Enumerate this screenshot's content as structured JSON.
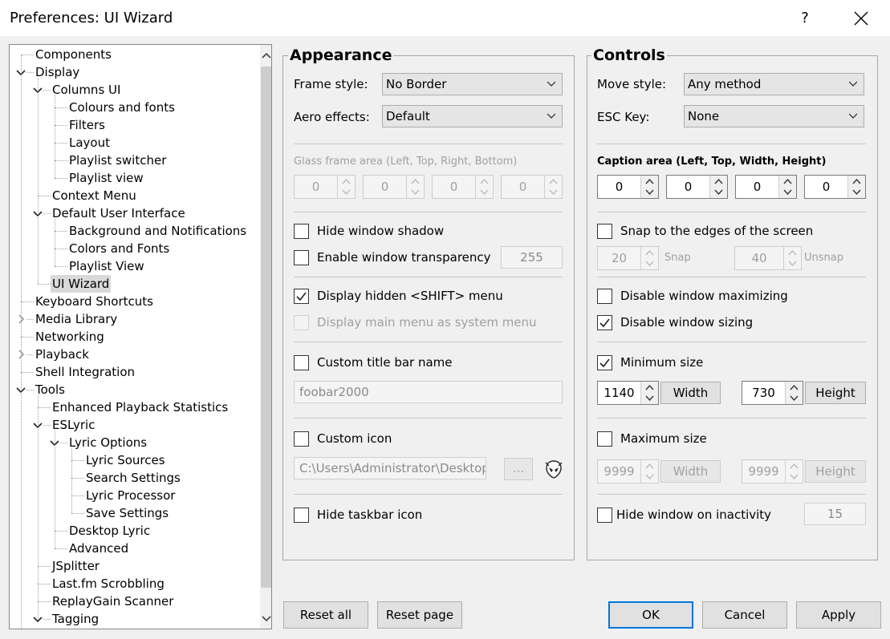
{
  "window": {
    "title": "Preferences: UI Wizard",
    "help": "?"
  },
  "tree": [
    {
      "label": "Components",
      "level": 0,
      "state": "leaf"
    },
    {
      "label": "Display",
      "level": 0,
      "state": "expanded"
    },
    {
      "label": "Columns UI",
      "level": 1,
      "state": "expanded"
    },
    {
      "label": "Colours and fonts",
      "level": 2,
      "state": "leaf"
    },
    {
      "label": "Filters",
      "level": 2,
      "state": "leaf"
    },
    {
      "label": "Layout",
      "level": 2,
      "state": "leaf"
    },
    {
      "label": "Playlist switcher",
      "level": 2,
      "state": "leaf"
    },
    {
      "label": "Playlist view",
      "level": 2,
      "state": "leaf"
    },
    {
      "label": "Context Menu",
      "level": 1,
      "state": "leaf"
    },
    {
      "label": "Default User Interface",
      "level": 1,
      "state": "expanded"
    },
    {
      "label": "Background and Notifications",
      "level": 2,
      "state": "leaf"
    },
    {
      "label": "Colors and Fonts",
      "level": 2,
      "state": "leaf"
    },
    {
      "label": "Playlist View",
      "level": 2,
      "state": "leaf"
    },
    {
      "label": "UI Wizard",
      "level": 1,
      "state": "leaf",
      "selected": true
    },
    {
      "label": "Keyboard Shortcuts",
      "level": 0,
      "state": "leaf"
    },
    {
      "label": "Media Library",
      "level": 0,
      "state": "collapsed"
    },
    {
      "label": "Networking",
      "level": 0,
      "state": "leaf"
    },
    {
      "label": "Playback",
      "level": 0,
      "state": "collapsed"
    },
    {
      "label": "Shell Integration",
      "level": 0,
      "state": "leaf"
    },
    {
      "label": "Tools",
      "level": 0,
      "state": "expanded"
    },
    {
      "label": "Enhanced Playback Statistics",
      "level": 1,
      "state": "leaf"
    },
    {
      "label": "ESLyric",
      "level": 1,
      "state": "expanded"
    },
    {
      "label": "Lyric Options",
      "level": 2,
      "state": "expanded"
    },
    {
      "label": "Lyric Sources",
      "level": 3,
      "state": "leaf"
    },
    {
      "label": "Search Settings",
      "level": 3,
      "state": "leaf"
    },
    {
      "label": "Lyric Processor",
      "level": 3,
      "state": "leaf"
    },
    {
      "label": "Save Settings",
      "level": 3,
      "state": "leaf"
    },
    {
      "label": "Desktop Lyric",
      "level": 2,
      "state": "leaf"
    },
    {
      "label": "Advanced",
      "level": 2,
      "state": "leaf"
    },
    {
      "label": "JSplitter",
      "level": 1,
      "state": "leaf"
    },
    {
      "label": "Last.fm Scrobbling",
      "level": 1,
      "state": "leaf"
    },
    {
      "label": "ReplayGain Scanner",
      "level": 1,
      "state": "leaf"
    },
    {
      "label": "Tagging",
      "level": 1,
      "state": "expanded"
    }
  ],
  "appearance": {
    "title": "Appearance",
    "frame_style_label": "Frame style:",
    "frame_style_value": "No Border",
    "aero_label": "Aero effects:",
    "aero_value": "Default",
    "glass_label": "Glass frame area (Left, Top, Right, Bottom)",
    "glass_values": [
      "0",
      "0",
      "0",
      "0"
    ],
    "hide_shadow": {
      "label": "Hide window shadow",
      "checked": false
    },
    "transparency": {
      "label": "Enable window transparency",
      "checked": false,
      "value": "255"
    },
    "shift_menu": {
      "label": "Display hidden <SHIFT> menu",
      "checked": true
    },
    "system_menu": {
      "label": "Display main menu as system menu",
      "checked": false
    },
    "custom_title": {
      "label": "Custom title bar name",
      "checked": false,
      "value": "foobar2000"
    },
    "custom_icon": {
      "label": "Custom icon",
      "checked": false,
      "path": "C:\\Users\\Administrator\\Desktop\\",
      "browse": "..."
    },
    "hide_taskbar": {
      "label": "Hide taskbar icon",
      "checked": false
    }
  },
  "controls": {
    "title": "Controls",
    "move_style_label": "Move style:",
    "move_style_value": "Any method",
    "esc_label": "ESC Key:",
    "esc_value": "None",
    "caption_label": "Caption area (Left, Top, Width, Height)",
    "caption_values": [
      "0",
      "0",
      "0",
      "0"
    ],
    "snap": {
      "label": "Snap to the edges of the screen",
      "checked": false,
      "snap_value": "20",
      "snap_label": "Snap",
      "unsnap_value": "40",
      "unsnap_label": "Unsnap"
    },
    "disable_max": {
      "label": "Disable window maximizing",
      "checked": false
    },
    "disable_sizing": {
      "label": "Disable window sizing",
      "checked": true
    },
    "min_size": {
      "label": "Minimum size",
      "checked": true,
      "width": "1140",
      "width_btn": "Width",
      "height": "730",
      "height_btn": "Height"
    },
    "max_size": {
      "label": "Maximum size",
      "checked": false,
      "width": "9999",
      "width_btn": "Width",
      "height": "9999",
      "height_btn": "Height"
    },
    "hide_inactivity": {
      "label": "Hide window on inactivity",
      "checked": false,
      "value": "15"
    }
  },
  "buttons": {
    "reset_all": "Reset all",
    "reset_page": "Reset page",
    "ok": "OK",
    "cancel": "Cancel",
    "apply": "Apply"
  },
  "colors": {
    "accent": "#0078d7",
    "selection": "#d9d9d9"
  }
}
